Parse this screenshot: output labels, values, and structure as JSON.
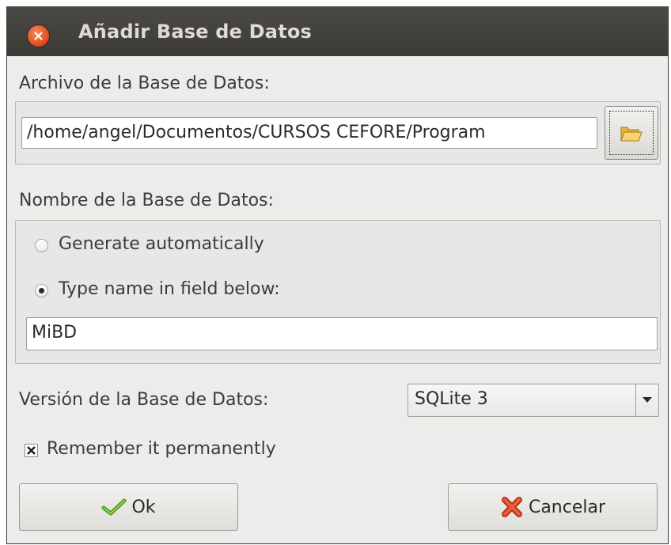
{
  "window": {
    "title": "Añadir Base de Datos"
  },
  "file_section": {
    "label": "Archivo de la Base de Datos:",
    "path_value": "/home/angel/Documentos/CURSOS CEFORE/Program"
  },
  "name_section": {
    "label": "Nombre de la Base de Datos:",
    "option_auto": "Generate automatically",
    "option_type": "Type name in field below:",
    "selected": "type",
    "name_value": "MiBD"
  },
  "version_section": {
    "label": "Versión de la Base de Datos:",
    "selected_value": "SQLite 3"
  },
  "remember": {
    "label": "Remember it permanently",
    "checked": true
  },
  "buttons": {
    "ok_label": "Ok",
    "cancel_label": "Cancelar"
  },
  "icons": {
    "close": "close-icon",
    "folder": "folder-open-icon",
    "ok": "checkmark-icon",
    "cancel": "cross-icon"
  },
  "colors": {
    "titlebar": "#3c3b37",
    "close_button": "#df4a16",
    "dialog_bg": "#edeceb"
  }
}
